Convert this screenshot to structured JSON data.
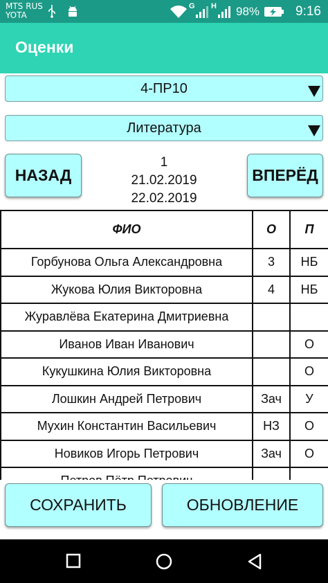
{
  "status_bar": {
    "carrier_line1": "MTS RUS",
    "carrier_line2": "YOTA",
    "network1": "G",
    "network2": "H",
    "battery_percent": "98%",
    "time": "9:16",
    "icons": [
      "usb-icon",
      "android-icon",
      "wifi-icon",
      "signal-icon",
      "battery-charging-icon"
    ]
  },
  "app_bar": {
    "title": "Оценки"
  },
  "group_spinner": {
    "selected": "4-ПР10"
  },
  "subject_spinner": {
    "selected": "Литература"
  },
  "nav": {
    "back_label": "НАЗАД",
    "forward_label": "ВПЕРЁД",
    "lesson_number": "1",
    "date_1": "21.02.2019",
    "date_2": "22.02.2019"
  },
  "table": {
    "headers": {
      "name": "ФИО",
      "o": "О",
      "p": "П"
    },
    "rows": [
      {
        "name": "Горбунова Ольга Александровна",
        "o": "3",
        "p": "НБ"
      },
      {
        "name": "Жукова Юлия Викторовна",
        "o": "4",
        "p": "НБ"
      },
      {
        "name": "Журавлёва Екатерина Дмитриевна",
        "o": "",
        "p": ""
      },
      {
        "name": "Иванов Иван Иванович",
        "o": "",
        "p": "О"
      },
      {
        "name": "Кукушкина Юлия Викторовна",
        "o": "",
        "p": "О"
      },
      {
        "name": "Лошкин Андрей Петрович",
        "o": "Зач",
        "p": "У"
      },
      {
        "name": "Мухин Константин Васильевич",
        "o": "НЗ",
        "p": "О"
      },
      {
        "name": "Новиков Игорь Петрович",
        "o": "Зач",
        "p": "О"
      },
      {
        "name": "Петров Пётр Петрович",
        "o": "",
        "p": ""
      }
    ]
  },
  "actions": {
    "save_label": "СОХРАНИТЬ",
    "refresh_label": "ОБНОВЛЕНИЕ"
  },
  "colors": {
    "status_bar": "#1b9a87",
    "app_bar": "#2ed4b4",
    "control_fill": "#b2ffff"
  }
}
